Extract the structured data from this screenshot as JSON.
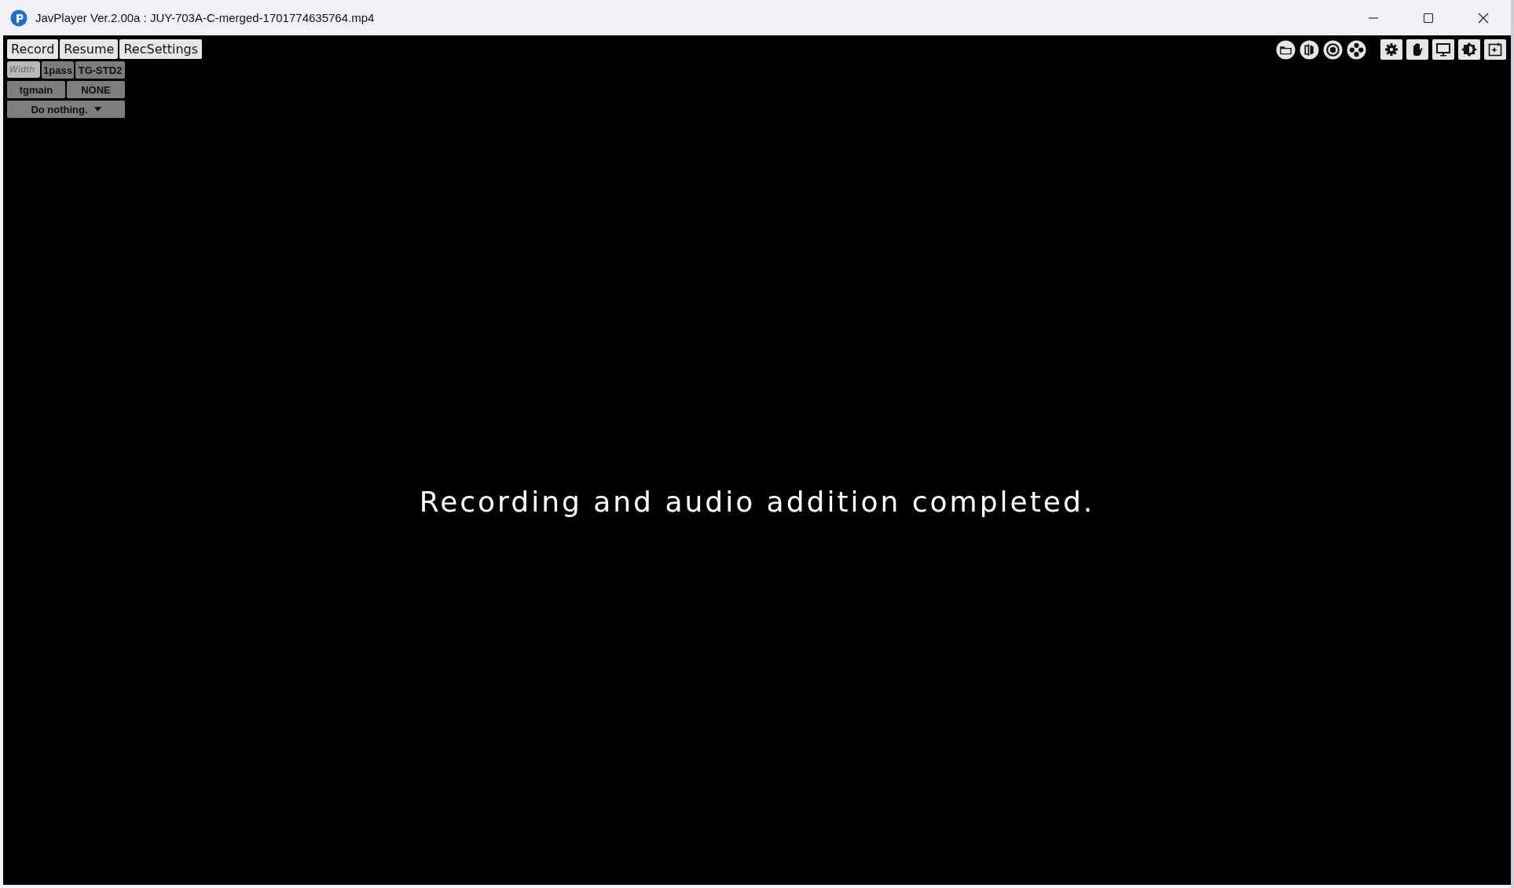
{
  "window": {
    "title": "JavPlayer Ver.2.00a : JUY-703A-C-merged-1701774635764.mp4"
  },
  "toolbar": {
    "buttons": [
      "Record",
      "Resume",
      "RecSettings"
    ]
  },
  "encode_panel": {
    "width_field": {
      "placeholder": "Width"
    },
    "row_1": [
      "1pass",
      "TG-STD2"
    ],
    "row_2": [
      "tgmain",
      "NONE"
    ],
    "dropdown": {
      "value": "Do nothing."
    }
  },
  "osd_message": "Recording and audio addition completed."
}
